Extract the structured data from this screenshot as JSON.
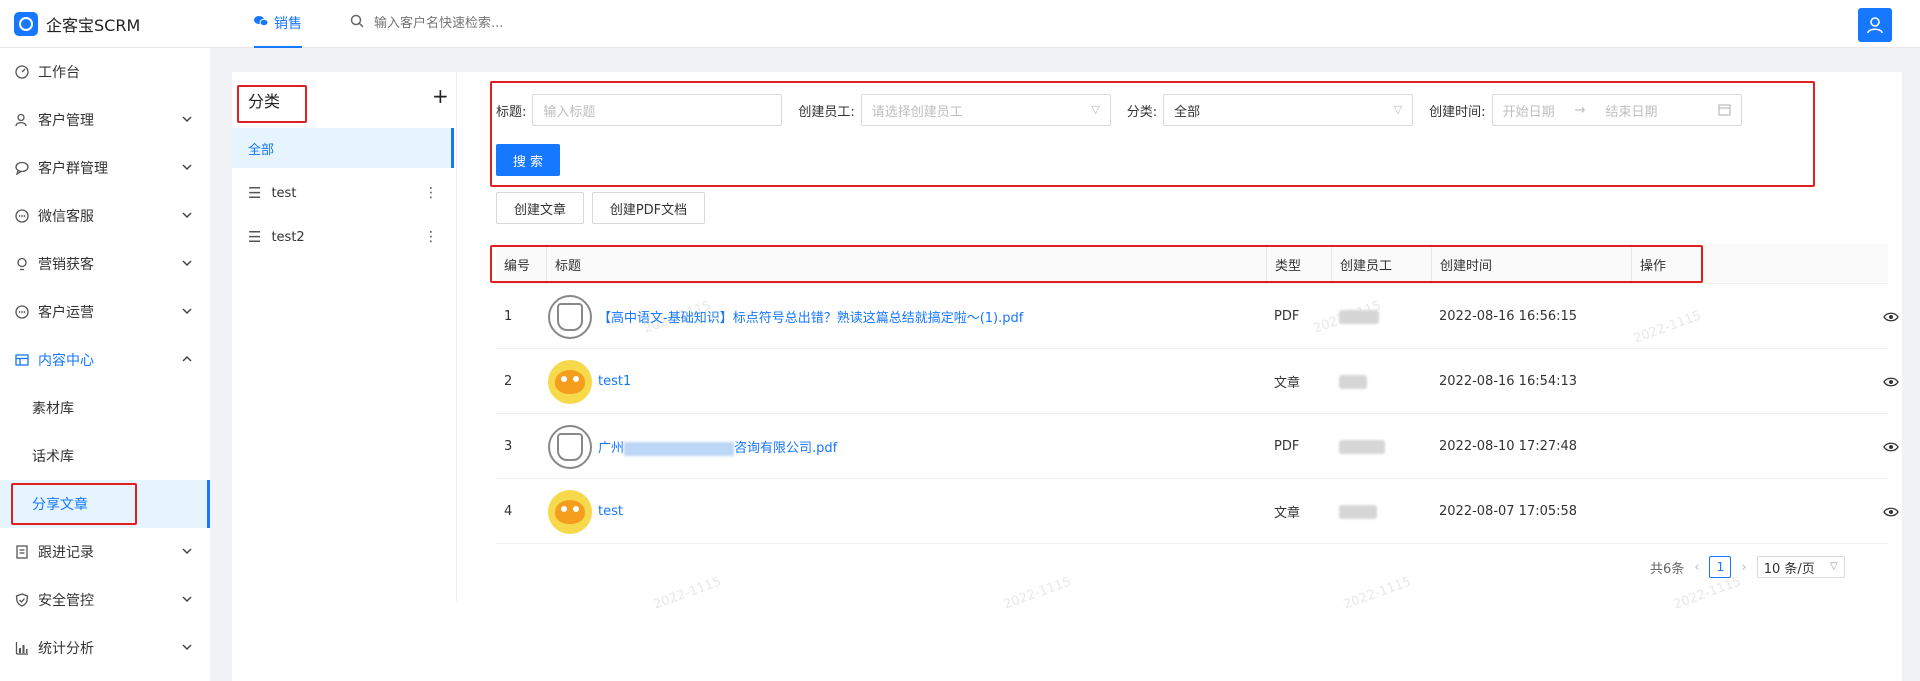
{
  "app": {
    "title": "企客宝SCRM"
  },
  "topnav": {
    "tab": "销售",
    "search_placeholder": "输入客户名快速检索..."
  },
  "sidebar": {
    "items": [
      {
        "label": "工作台",
        "icon": "dashboard-icon"
      },
      {
        "label": "客户管理",
        "icon": "customer-icon"
      },
      {
        "label": "客户群管理",
        "icon": "group-chat-icon"
      },
      {
        "label": "微信客服",
        "icon": "service-icon"
      },
      {
        "label": "营销获客",
        "icon": "bulb-icon"
      },
      {
        "label": "客户运营",
        "icon": "ops-icon"
      },
      {
        "label": "内容中心",
        "icon": "content-icon"
      },
      {
        "label": "跟进记录",
        "icon": "record-icon"
      },
      {
        "label": "安全管控",
        "icon": "shield-icon"
      },
      {
        "label": "统计分析",
        "icon": "chart-icon"
      }
    ],
    "sub_items": [
      "素材库",
      "话术库",
      "分享文章"
    ]
  },
  "categories": {
    "title": "分类",
    "add_label": "+",
    "items": [
      "全部",
      "test",
      "test2"
    ]
  },
  "filters": {
    "title_label": "标题:",
    "title_placeholder": "输入标题",
    "creator_label": "创建员工:",
    "creator_placeholder": "请选择创建员工",
    "category_label": "分类:",
    "category_value": "全部",
    "time_label": "创建时间:",
    "start_placeholder": "开始日期",
    "end_placeholder": "结束日期",
    "search_button": "搜 索"
  },
  "actions": {
    "create_article": "创建文章",
    "create_pdf": "创建PDF文档"
  },
  "table": {
    "headers": [
      "编号",
      "标题",
      "类型",
      "创建员工",
      "创建时间",
      "操作"
    ],
    "rows": [
      {
        "no": "1",
        "title": "【高中语文-基础知识】标点符号总出错？熟读这篇总结就搞定啦～(1).pdf",
        "type": "PDF",
        "time": "2022-08-16 16:56:15",
        "thumb": "pdf"
      },
      {
        "no": "2",
        "title": "test1",
        "type": "文章",
        "time": "2022-08-16 16:54:13",
        "thumb": "cat"
      },
      {
        "no": "3",
        "title_prefix": "广州",
        "title_suffix": "咨询有限公司.pdf",
        "type": "PDF",
        "time": "2022-08-10 17:27:48",
        "thumb": "pdf"
      },
      {
        "no": "4",
        "title": "test",
        "type": "文章",
        "time": "2022-08-07 17:05:58",
        "thumb": "cat"
      }
    ]
  },
  "pagination": {
    "total": "共6条",
    "current": "1",
    "page_size": "10 条/页"
  },
  "watermark": {
    "text": "2022-1115"
  },
  "colors": {
    "primary": "#1677ff",
    "highlight": "#e02020"
  }
}
